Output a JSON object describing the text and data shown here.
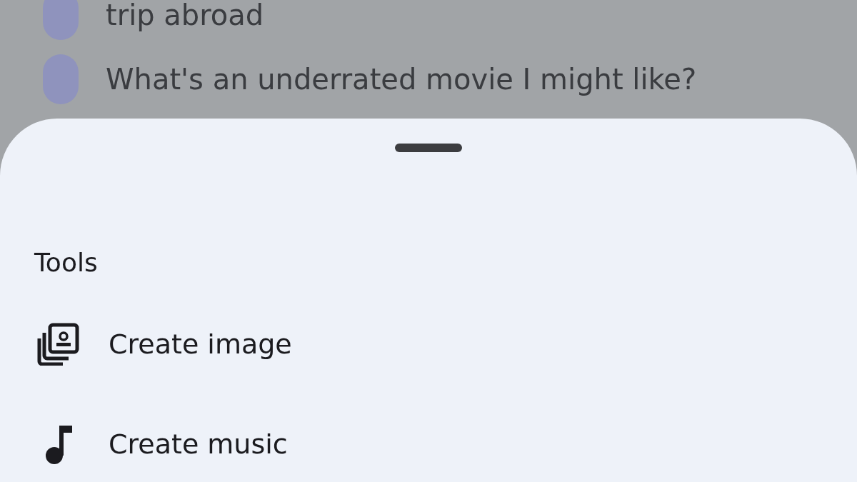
{
  "suggestions": [
    {
      "text": "trip abroad"
    },
    {
      "text": "What's an underrated movie I might like?"
    }
  ],
  "sheet": {
    "title": "Tools",
    "items": [
      {
        "label": "Create image",
        "kind": "image"
      },
      {
        "label": "Create music",
        "kind": "music"
      }
    ]
  }
}
